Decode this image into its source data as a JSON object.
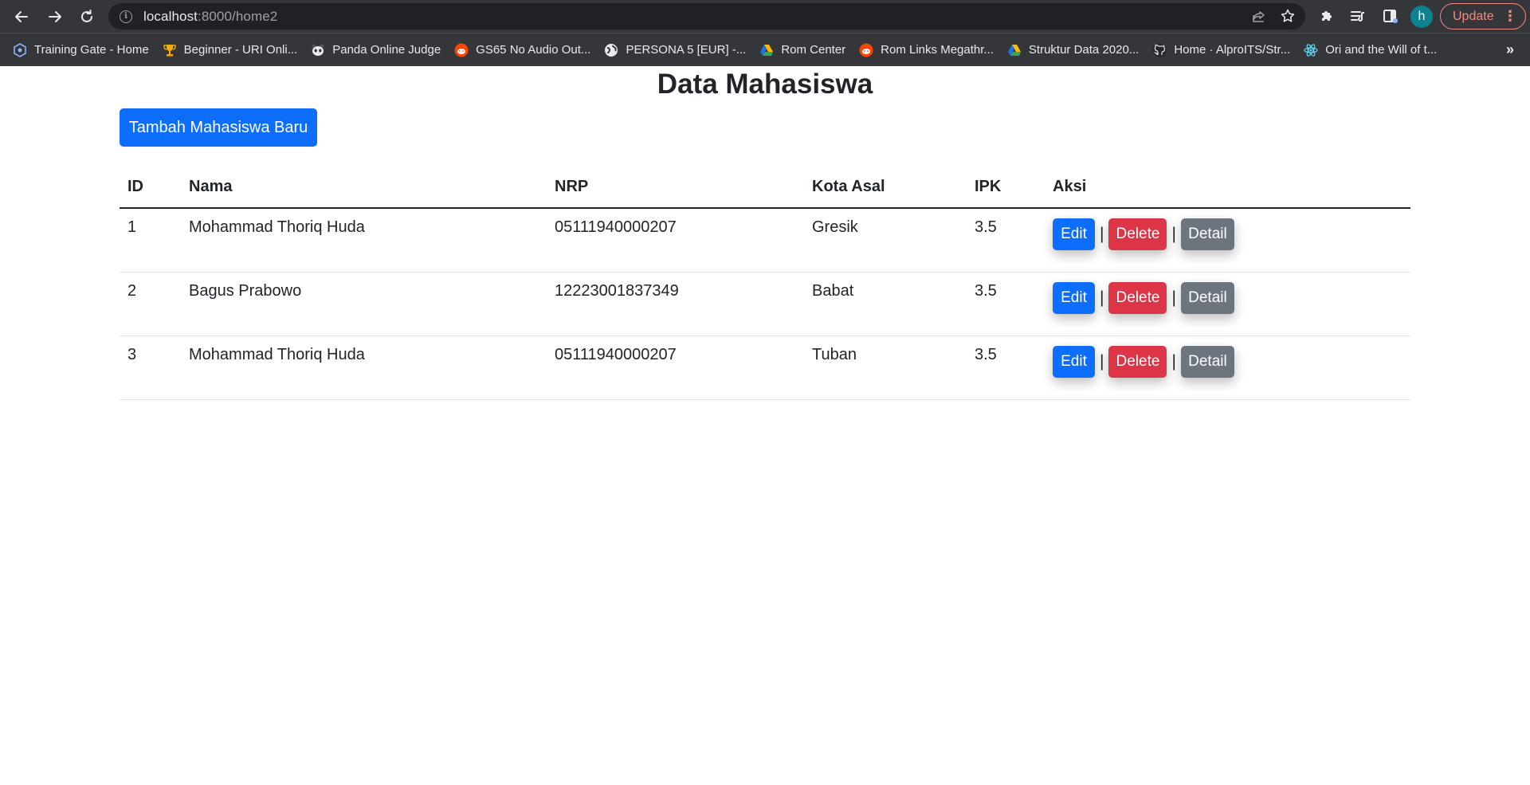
{
  "browser": {
    "url_host": "localhost",
    "url_path": ":8000/home2",
    "avatar_letter": "h",
    "update_label": "Update",
    "bookmarks": [
      {
        "label": "Training Gate - Home",
        "icon": "training-gate-icon",
        "color": "#8ab4f8"
      },
      {
        "label": "Beginner - URI Onli...",
        "icon": "trophy-icon",
        "color": "#f9ab00"
      },
      {
        "label": "Panda Online Judge",
        "icon": "panda-icon",
        "color": "#e8eaed"
      },
      {
        "label": "GS65 No Audio Out...",
        "icon": "reddit-icon",
        "color": "#ff4500"
      },
      {
        "label": "PERSONA 5 [EUR] -...",
        "icon": "globe-icon",
        "color": "#e8eaed"
      },
      {
        "label": "Rom Center",
        "icon": "drive-icon",
        "color": "#34a853"
      },
      {
        "label": "Rom Links Megathr...",
        "icon": "reddit-icon",
        "color": "#ff4500"
      },
      {
        "label": "Struktur Data 2020...",
        "icon": "drive-icon",
        "color": "#34a853"
      },
      {
        "label": "Home · AlproITS/Str...",
        "icon": "github-icon",
        "color": "#e8eaed"
      },
      {
        "label": "Ori and the Will of t...",
        "icon": "react-icon",
        "color": "#61dafb"
      }
    ]
  },
  "page": {
    "title": "Data Mahasiswa",
    "add_button": "Tambah Mahasiswa Baru"
  },
  "table": {
    "headers": [
      "ID",
      "Nama",
      "NRP",
      "Kota Asal",
      "IPK",
      "Aksi"
    ],
    "rows": [
      {
        "id": "1",
        "nama": "Mohammad Thoriq Huda",
        "nrp": "05111940000207",
        "kota": "Gresik",
        "ipk": "3.5"
      },
      {
        "id": "2",
        "nama": "Bagus Prabowo",
        "nrp": "12223001837349",
        "kota": "Babat",
        "ipk": "3.5"
      },
      {
        "id": "3",
        "nama": "Mohammad Thoriq Huda",
        "nrp": "05111940000207",
        "kota": "Tuban",
        "ipk": "3.5"
      }
    ],
    "actions": {
      "edit": "Edit",
      "delete": "Delete",
      "detail": "Detail",
      "separator": "|"
    }
  },
  "colors": {
    "primary": "#0d6efd",
    "danger": "#dc3545",
    "secondary": "#6c757d"
  }
}
